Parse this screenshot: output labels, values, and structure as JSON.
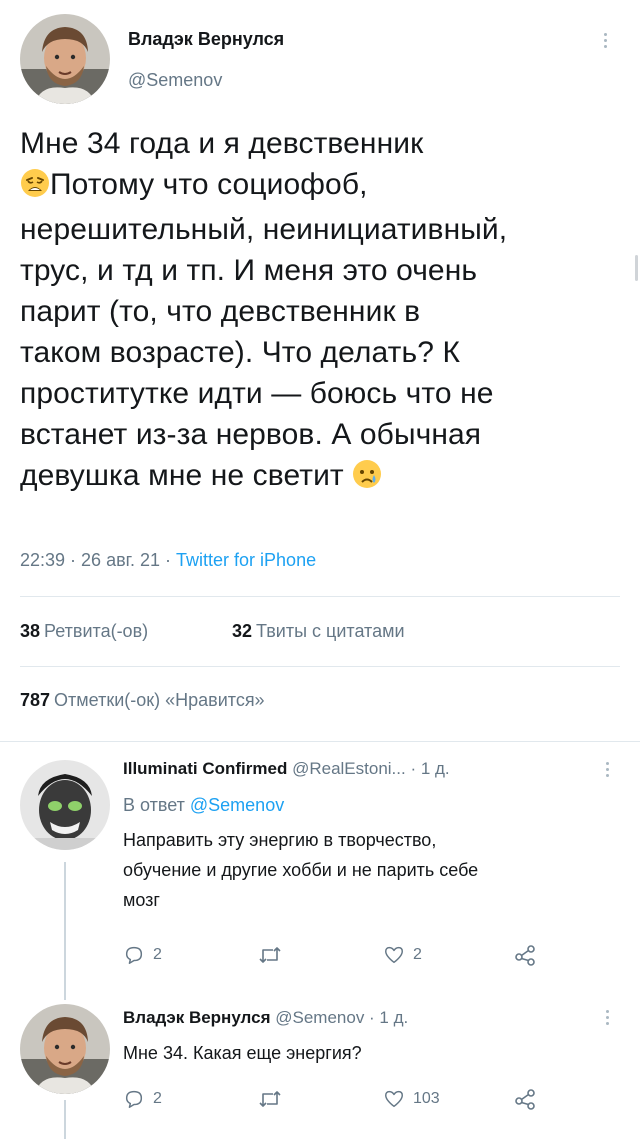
{
  "tweet": {
    "author_name": "Владэк Вернулся",
    "author_handle": "@Semenov",
    "text_lines": [
      "Мне 34 года и я девственник",
      "Потому что социофоб,",
      "нерешительный, неинициативный,",
      "трус, и тд и тп. И меня это очень",
      "парит (то, что девственник в",
      "таком возрасте). Что делать? К",
      "проститутке идти — боюсь что не",
      "встанет из-за нервов. А обычная",
      "девушка мне не светит"
    ],
    "time": "22:39 · 26 авг. 21 · ",
    "source": "Twitter for iPhone",
    "retweets_count": "38",
    "retweets_label": "Ретвита(-ов)",
    "quotes_count": "32",
    "quotes_label": "Твиты с цитатами",
    "likes_count": "787",
    "likes_label": "Отметки(-ок) «Нравится»"
  },
  "replies": [
    {
      "name": "Illuminati Confirmed",
      "meta": "@RealEstoni... · 1 д.",
      "reply_prefix": "В ответ ",
      "reply_handle": "@Semenov",
      "text_lines": [
        "Направить эту энергию в творчество,",
        "обучение и другие хобби и не парить себе",
        "мозг"
      ],
      "reply_count": "2",
      "retweet_count": "",
      "like_count": "2"
    },
    {
      "name": "Владэк Вернулся",
      "meta": "@Semenov · 1 д.",
      "text_lines": [
        "Мне 34. Какая еще энергия?"
      ],
      "reply_count": "2",
      "retweet_count": "",
      "like_count": "103"
    }
  ],
  "icons": {
    "reply": "comment-icon",
    "retweet": "retweet-icon",
    "like": "heart-icon",
    "share": "share-icon",
    "more": "more-vertical-icon",
    "emoji_1": "weary-face-emoji",
    "emoji_2": "crying-face-emoji"
  },
  "colors": {
    "text": "#14171a",
    "secondary": "#657786",
    "link": "#1da1f2",
    "divider": "#e1e8ed"
  }
}
